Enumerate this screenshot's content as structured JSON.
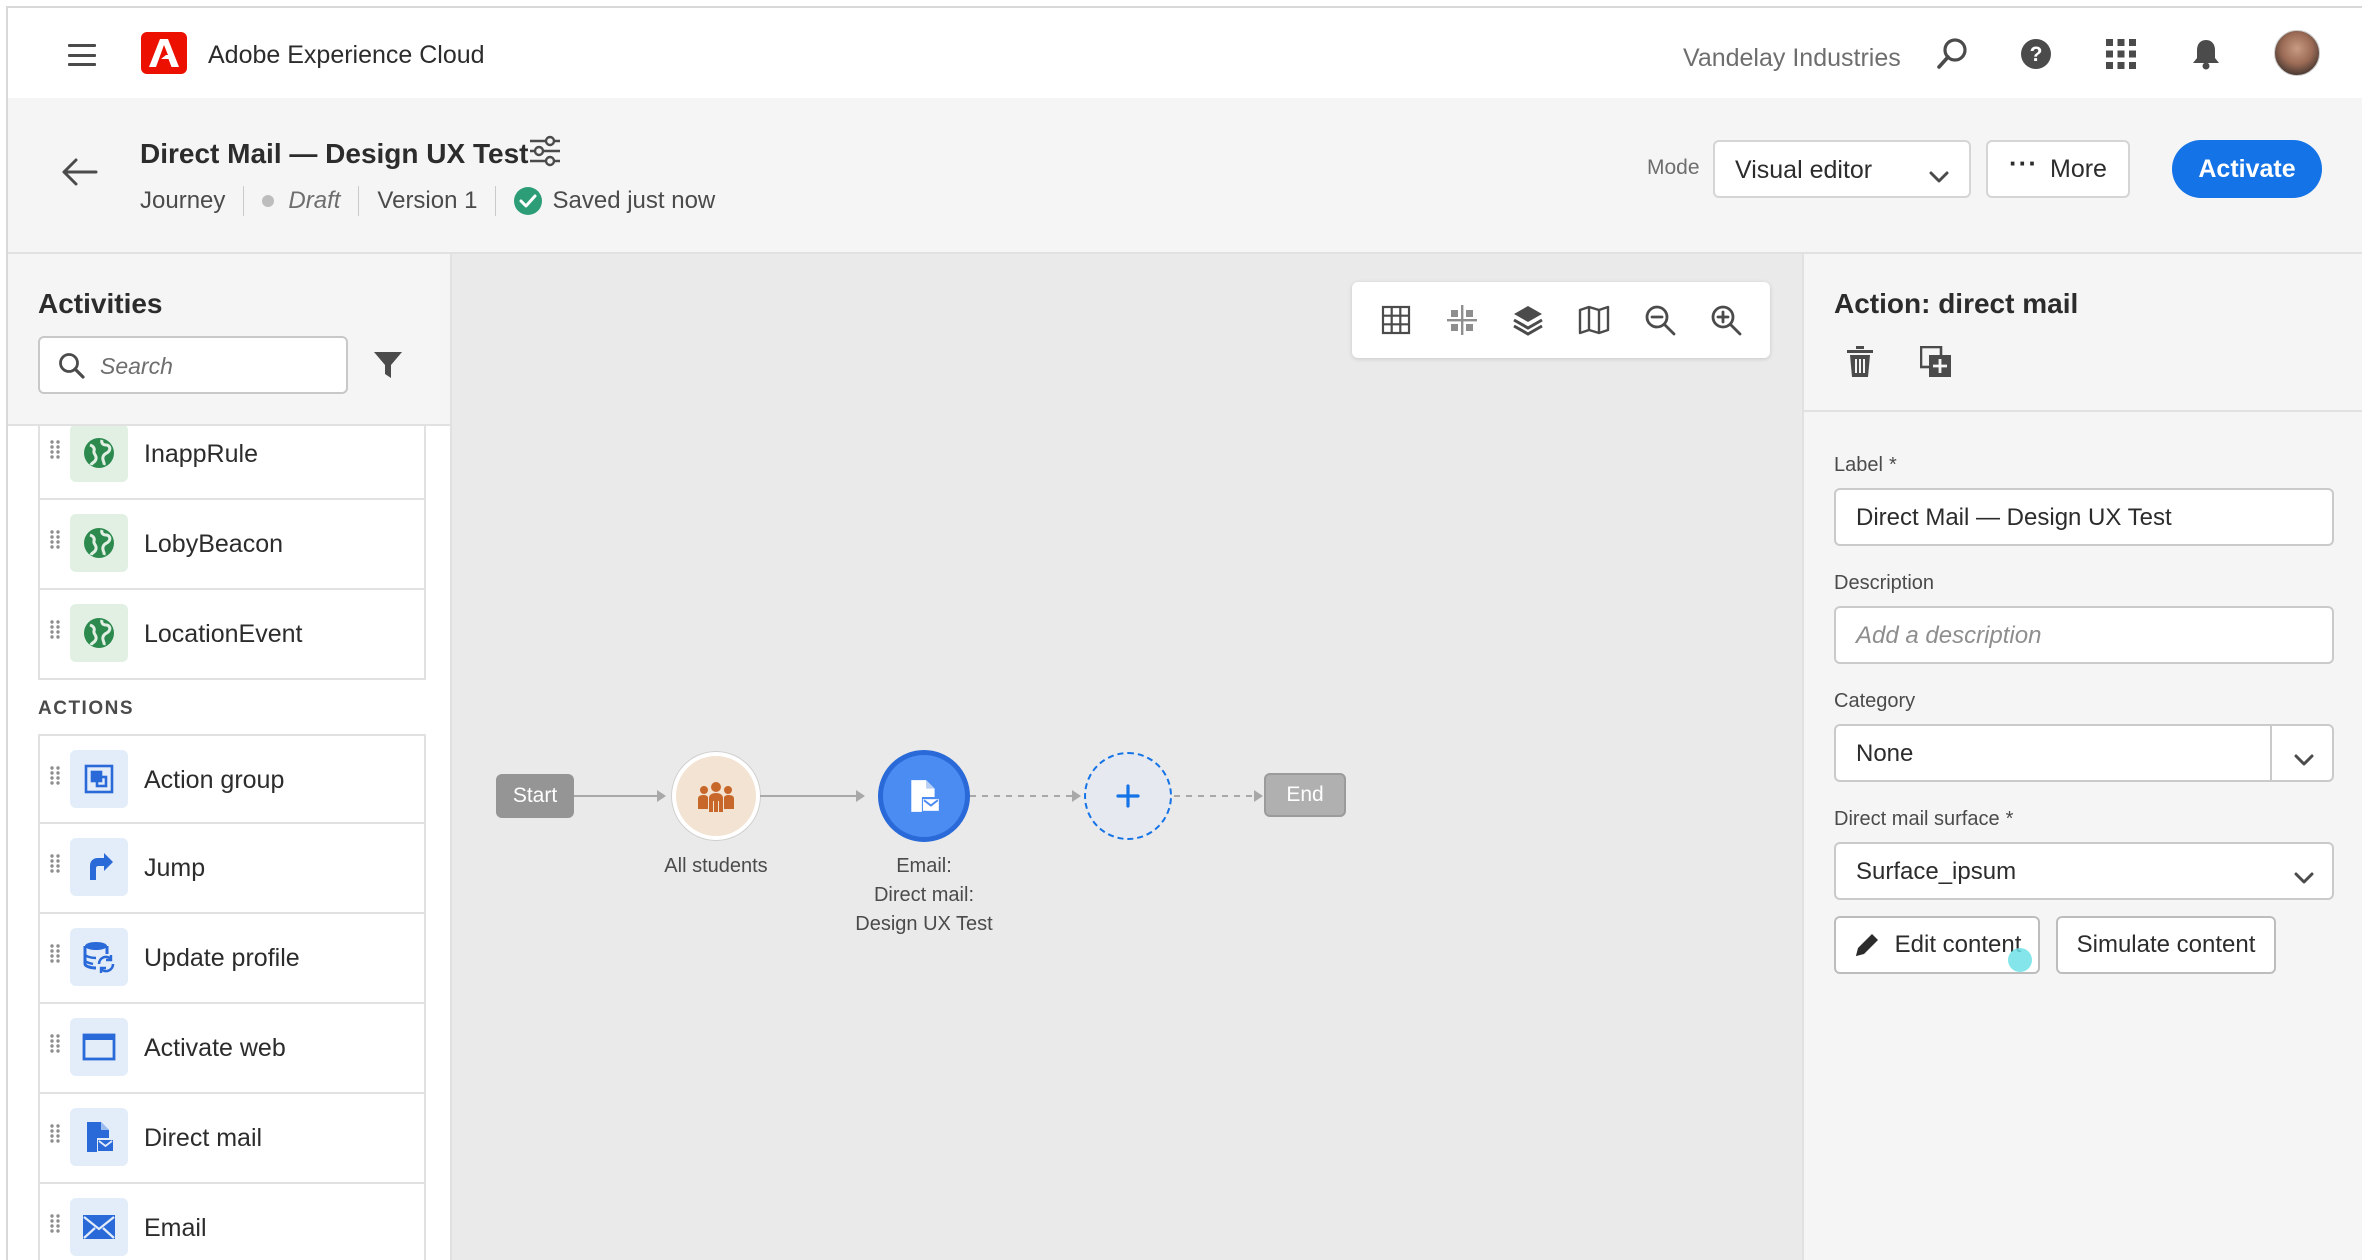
{
  "app": {
    "name": "Adobe Experience Cloud",
    "org": "Vandelay Industries"
  },
  "journey": {
    "title": "Direct Mail — Design UX Test",
    "type": "Journey",
    "status": "Draft",
    "version": "Version 1",
    "saved": "Saved just now",
    "mode_label": "Mode",
    "mode_value": "Visual editor",
    "more_label": "More",
    "activate_label": "Activate"
  },
  "palette": {
    "title": "Activities",
    "search_placeholder": "Search",
    "events": [
      {
        "label": "InappRule",
        "icon": "globe-icon"
      },
      {
        "label": "LobyBeacon",
        "icon": "globe-icon"
      },
      {
        "label": "LocationEvent",
        "icon": "globe-icon"
      }
    ],
    "actions_header": "ACTIONS",
    "actions": [
      {
        "label": "Action group",
        "icon": "action-group-icon"
      },
      {
        "label": "Jump",
        "icon": "jump-icon"
      },
      {
        "label": "Update profile",
        "icon": "update-profile-icon"
      },
      {
        "label": "Activate web",
        "icon": "browser-window-icon"
      },
      {
        "label": "Direct mail",
        "icon": "direct-mail-icon"
      },
      {
        "label": "Email",
        "icon": "envelope-icon"
      }
    ]
  },
  "canvas": {
    "start_label": "Start",
    "end_label": "End",
    "segment_node_label": "All students",
    "mail_node_label_1": "Email:",
    "mail_node_label_2": "Direct mail:",
    "mail_node_label_3": "Design UX Test",
    "toolbar": [
      "grid-icon",
      "align-icon",
      "layers-icon",
      "map-icon",
      "zoom-out-icon",
      "zoom-in-icon"
    ]
  },
  "properties": {
    "title": "Action: direct mail",
    "label_field_label": "Label",
    "label_value": "Direct Mail — Design UX Test",
    "description_label": "Description",
    "description_placeholder": "Add a description",
    "category_label": "Category",
    "category_value": "None",
    "surface_label": "Direct mail surface",
    "surface_value": "Surface_ipsum",
    "required_marker": "*",
    "edit_content_label": "Edit content",
    "simulate_content_label": "Simulate content"
  },
  "colors": {
    "accent": "#1473e6",
    "adobe_red": "#eb1000",
    "success": "#2d9d78"
  }
}
